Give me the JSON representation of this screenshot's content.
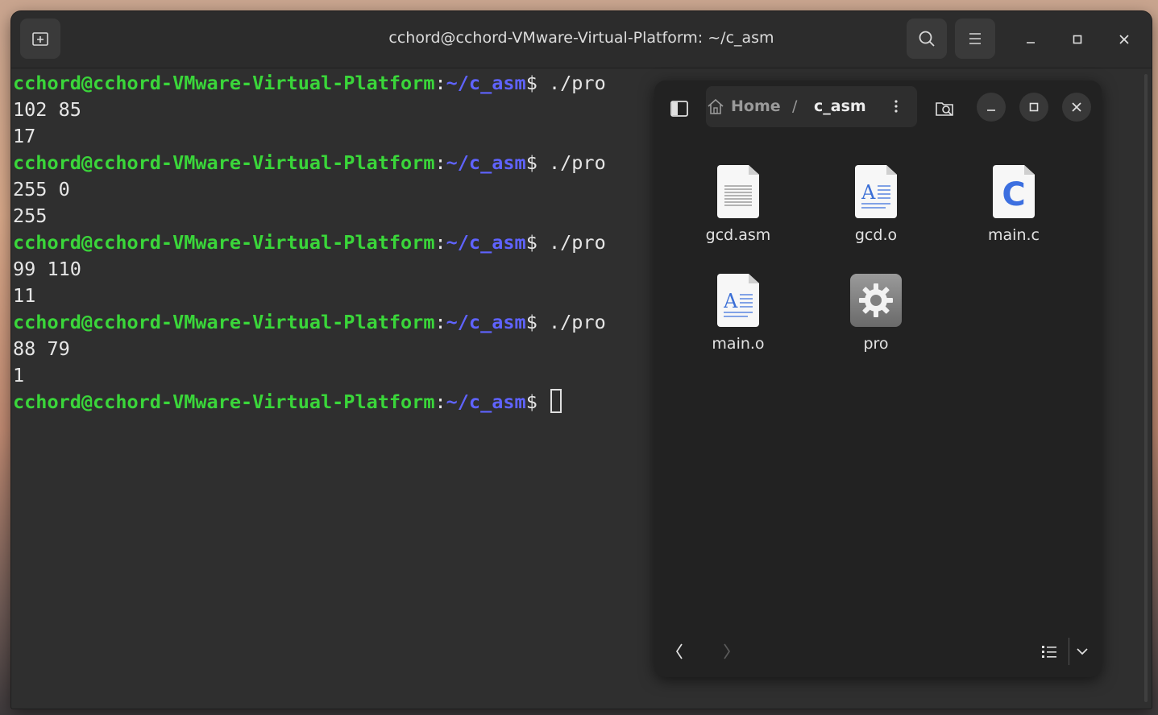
{
  "terminal": {
    "title": "cchord@cchord-VMware-Virtual-Platform: ~/c_asm",
    "prompt_user": "cchord@cchord-VMware-Virtual-Platform",
    "prompt_sep": ":",
    "prompt_path": "~/c_asm",
    "prompt_end": "$ ",
    "lines": [
      {
        "type": "prompt",
        "cmd": "./pro"
      },
      {
        "type": "out",
        "text": "102 85"
      },
      {
        "type": "out",
        "text": "17"
      },
      {
        "type": "prompt",
        "cmd": "./pro"
      },
      {
        "type": "out",
        "text": "255 0"
      },
      {
        "type": "out",
        "text": "255"
      },
      {
        "type": "prompt",
        "cmd": "./pro"
      },
      {
        "type": "out",
        "text": "99 110"
      },
      {
        "type": "out",
        "text": "11"
      },
      {
        "type": "prompt",
        "cmd": "./pro"
      },
      {
        "type": "out",
        "text": "88 79"
      },
      {
        "type": "out",
        "text": "1"
      },
      {
        "type": "prompt",
        "cmd": "",
        "cursor": true
      }
    ]
  },
  "files": {
    "breadcrumb": [
      "Home",
      "/",
      "c_asm"
    ],
    "items": [
      {
        "name": "gcd.asm",
        "icon": "text-file-icon"
      },
      {
        "name": "gcd.o",
        "icon": "object-file-icon"
      },
      {
        "name": "main.c",
        "icon": "c-source-icon"
      },
      {
        "name": "main.o",
        "icon": "object-file-icon"
      },
      {
        "name": "pro",
        "icon": "executable-gear-icon"
      }
    ]
  },
  "colors": {
    "prompt_user": "#3ad63a",
    "prompt_path": "#5f63ff",
    "background": "#2f2f2f"
  }
}
